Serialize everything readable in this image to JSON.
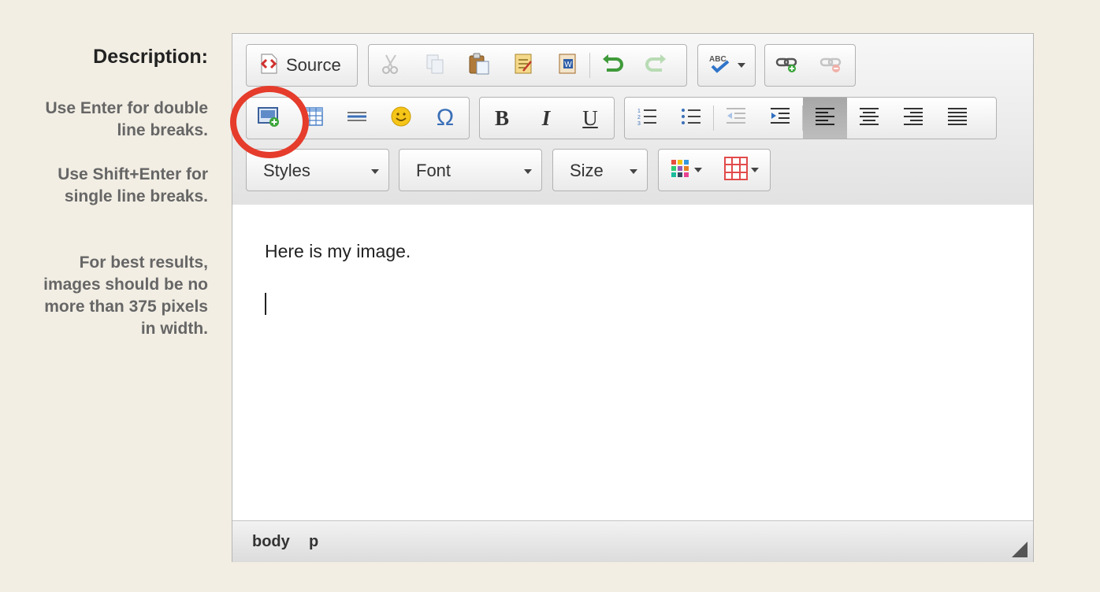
{
  "sidebar": {
    "title": "Description:",
    "notes": [
      [
        "Use Enter for double",
        "line breaks."
      ],
      [
        "Use Shift+Enter for",
        "single line breaks."
      ],
      [
        "For best results,",
        "images should be no",
        "more than 375 pixels",
        "in width."
      ]
    ]
  },
  "toolbar": {
    "source_label": "Source",
    "styles_label": "Styles",
    "font_label": "Font",
    "size_label": "Size",
    "active_button": "align-left-button"
  },
  "content": {
    "paragraph": "Here is my image."
  },
  "statusbar": {
    "path": [
      "body",
      "p"
    ]
  },
  "annotation": {
    "color": "#e53c2c",
    "target": "image-button"
  }
}
